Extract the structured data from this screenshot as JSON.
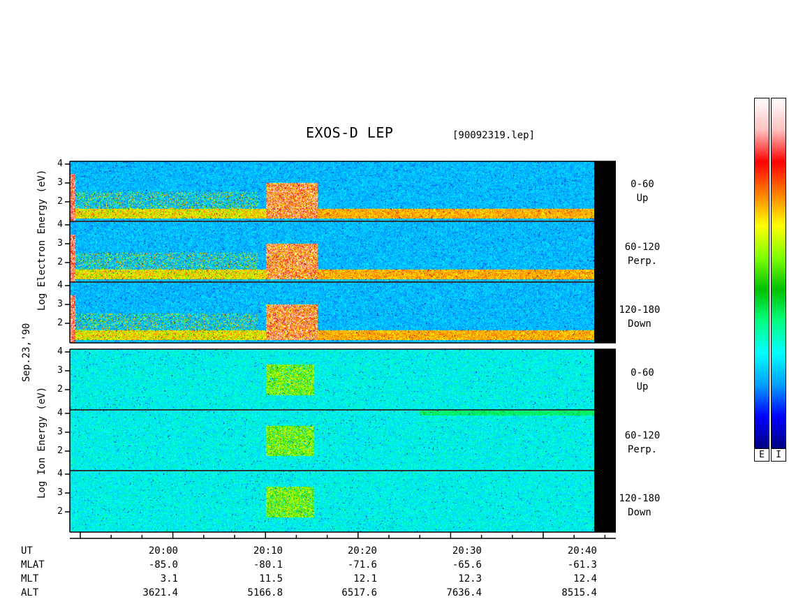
{
  "header": {
    "title": "EXOS-D LEP",
    "filename": "[90092319.lep]"
  },
  "date_label": "Sep.23,'90",
  "electron_axis_label": "Log Electron Energy (eV)",
  "ion_axis_label": "Log Ion Energy (eV)",
  "ytick_labels": [
    "4",
    "3",
    "2"
  ],
  "channels": [
    {
      "range": "0-60",
      "dir": "Up"
    },
    {
      "range": "60-120",
      "dir": "Perp."
    },
    {
      "range": "120-180",
      "dir": "Down"
    }
  ],
  "x_axis": {
    "rows": [
      {
        "name": "UT",
        "values": [
          "20:00",
          "20:10",
          "20:20",
          "20:30",
          "20:40"
        ]
      },
      {
        "name": "MLAT",
        "values": [
          "-85.0",
          "-80.1",
          "-71.6",
          "-65.6",
          "-61.3"
        ]
      },
      {
        "name": "MLT",
        "values": [
          "3.1",
          "11.5",
          "12.1",
          "12.3",
          "12.4"
        ]
      },
      {
        "name": "ALT",
        "values": [
          "3621.4",
          "5166.8",
          "6517.6",
          "7636.4",
          "8515.4"
        ]
      }
    ]
  },
  "colorbar": {
    "labels": [
      "E",
      "I"
    ]
  },
  "colors": {
    "background_field": "#1030c8",
    "colorscale": [
      "#000080",
      "#0000ff",
      "#00a0ff",
      "#00ffff",
      "#00ff80",
      "#00c000",
      "#80ff00",
      "#ffff00",
      "#ff8000",
      "#ff0000",
      "#ffc0c0",
      "#ffffff"
    ]
  },
  "chart_data": {
    "type": "heatmap",
    "x_unit": "UT",
    "x_ticks": [
      "20:00",
      "20:10",
      "20:20",
      "20:30",
      "20:40"
    ],
    "y_unit": "log10 energy (eV)",
    "y_ticks": [
      4,
      3,
      2
    ],
    "panels": [
      {
        "species": "electron",
        "pitch_angle": "0-60",
        "direction": "Up",
        "features": "low-energy band near 1.5 throughout; intense burst up to ~2.8 near 20:10-20:15"
      },
      {
        "species": "electron",
        "pitch_angle": "60-120",
        "direction": "Perp.",
        "features": "low-energy band near 1.5; intense burst near 20:10-20:15"
      },
      {
        "species": "electron",
        "pitch_angle": "120-180",
        "direction": "Down",
        "features": "low-energy band near 1.5; intense burst near 20:10-20:15"
      },
      {
        "species": "ion",
        "pitch_angle": "0-60",
        "direction": "Up",
        "features": "localized enhancement ~2.0-2.8 near 20:10-20:14"
      },
      {
        "species": "ion",
        "pitch_angle": "60-120",
        "direction": "Perp.",
        "features": "localized enhancement ~2.0-2.8 near 20:10-20:14; weak band near 4 after 20:30"
      },
      {
        "species": "ion",
        "pitch_angle": "120-180",
        "direction": "Down",
        "features": "localized enhancement ~2.0-2.8 near 20:10-20:14"
      }
    ]
  }
}
